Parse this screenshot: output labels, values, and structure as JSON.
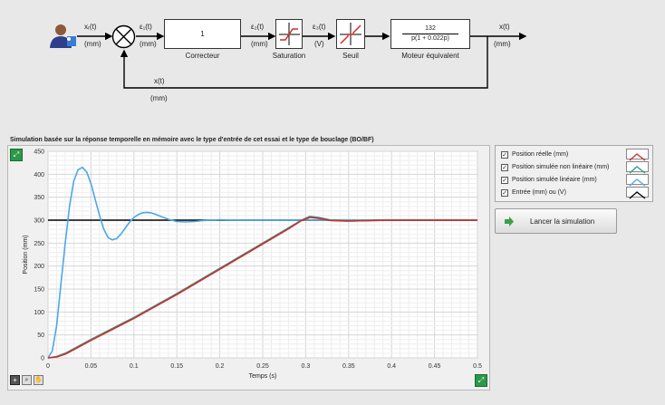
{
  "diagram": {
    "x_ref": "xᵣ(t)",
    "x_ref_unit": "(mm)",
    "e1": "ε₁(t)",
    "e1_unit": "(mm)",
    "corrector_value": "1",
    "corrector_caption": "Correcteur",
    "e2": "ε₂(t)",
    "e2_unit": "(mm)",
    "saturation_caption": "Saturation",
    "e3": "ε₃(t)",
    "e3_unit": "(V)",
    "seuil_caption": "Seuil",
    "motor_num": "132",
    "motor_den": "p(1 + 0.022p)",
    "motor_caption": "Moteur équivalent",
    "x_out": "x(t)",
    "x_out_unit": "(mm)",
    "feedback": "x(t)",
    "feedback_unit": "(mm)"
  },
  "simulation": {
    "title": "Simulation basée sur la réponse temporelle  en mémoire avec le type d'entrée de cet essai et le type de bouclage (BO/BF)"
  },
  "legend": [
    {
      "label": "Position réelle (mm)",
      "color": "#d42a2a",
      "checked": true
    },
    {
      "label": "Position simulée non linéaire (mm)",
      "color": "#2a9a8a",
      "checked": true
    },
    {
      "label": "Position simulée linéaire (mm)",
      "color": "#4aa8e8",
      "checked": true
    },
    {
      "label": "Entrée (mm) ou (V)",
      "color": "#000000",
      "checked": true
    }
  ],
  "button": {
    "label": "Lancer la simulation"
  },
  "chart_data": {
    "type": "line",
    "xlabel": "Temps (s)",
    "ylabel": "Position (mm)",
    "xlim": [
      0,
      0.5
    ],
    "ylim": [
      0,
      450
    ],
    "xticks": [
      "0",
      "0.05",
      "0.1",
      "0.15",
      "0.2",
      "0.25",
      "0.3",
      "0.35",
      "0.4",
      "0.45",
      "0.5"
    ],
    "yticks": [
      "0",
      "50",
      "100",
      "150",
      "200",
      "250",
      "300",
      "350",
      "400",
      "450"
    ],
    "grid": true,
    "series": [
      {
        "name": "Entrée (mm) ou (V)",
        "color": "#000000",
        "x": [
          0,
          0.5
        ],
        "y": [
          300,
          300
        ]
      },
      {
        "name": "Position simulée linéaire (mm)",
        "color": "#4aa8e8",
        "x": [
          0,
          0.005,
          0.01,
          0.015,
          0.02,
          0.025,
          0.03,
          0.035,
          0.04,
          0.045,
          0.05,
          0.055,
          0.06,
          0.065,
          0.07,
          0.075,
          0.08,
          0.085,
          0.09,
          0.095,
          0.1,
          0.105,
          0.11,
          0.115,
          0.12,
          0.125,
          0.13,
          0.14,
          0.15,
          0.16,
          0.17,
          0.18,
          0.2,
          0.22,
          0.25,
          0.3,
          0.38
        ],
        "y": [
          0,
          15,
          70,
          160,
          250,
          330,
          385,
          410,
          415,
          405,
          380,
          345,
          310,
          280,
          262,
          257,
          260,
          270,
          283,
          296,
          306,
          312,
          316,
          317,
          316,
          313,
          309,
          302,
          297,
          296,
          297,
          299,
          301,
          300,
          300,
          300,
          300
        ]
      },
      {
        "name": "Position simulée non linéaire (mm)",
        "color": "#2a9a8a",
        "x": [
          0,
          0.01,
          0.02,
          0.03,
          0.05,
          0.1,
          0.15,
          0.2,
          0.25,
          0.28,
          0.295,
          0.305,
          0.315,
          0.33,
          0.35,
          0.4,
          0.5
        ],
        "y": [
          0,
          3,
          10,
          20,
          40,
          88,
          140,
          195,
          250,
          283,
          300,
          308,
          306,
          300,
          298,
          300,
          300
        ]
      },
      {
        "name": "Position réelle (mm)",
        "color": "#d42a2a",
        "x": [
          0,
          0.01,
          0.02,
          0.03,
          0.05,
          0.1,
          0.15,
          0.2,
          0.25,
          0.28,
          0.295,
          0.305,
          0.315,
          0.33,
          0.35,
          0.4,
          0.5
        ],
        "y": [
          0,
          2,
          8,
          18,
          38,
          86,
          138,
          193,
          248,
          281,
          299,
          306,
          304,
          299,
          298,
          300,
          300
        ]
      }
    ]
  }
}
